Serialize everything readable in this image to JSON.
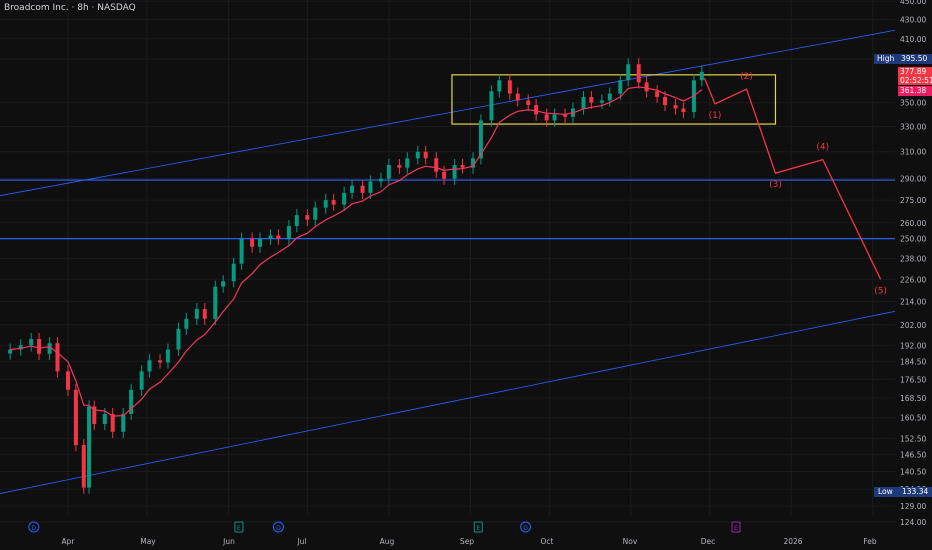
{
  "header": {
    "title": "Broadcom Inc. · 8h · NASDAQ"
  },
  "chart_data": {
    "type": "candlestick",
    "y_scale": "log",
    "ylim": [
      122,
      455
    ],
    "grid": true,
    "colors": {
      "up": "#089981",
      "down": "#f23645",
      "ema": "#f23660",
      "channel": "#2962ff",
      "box": "#e8d44d",
      "wave": "#f23645",
      "background": "#0f0f0f"
    },
    "y_ticks": [
      "450.00",
      "430.00",
      "410.00",
      "390.00",
      "350.00",
      "330.00",
      "310.00",
      "290.00",
      "275.00",
      "260.00",
      "250.00",
      "238.00",
      "226.00",
      "214.00",
      "202.00",
      "192.00",
      "184.50",
      "176.50",
      "168.50",
      "160.50",
      "152.50",
      "146.50",
      "140.50",
      "134.50",
      "129.00",
      "124.00"
    ],
    "x_ticks": [
      {
        "label": "Apr",
        "date": "2025-04-01"
      },
      {
        "label": "May",
        "date": "2025-05-01"
      },
      {
        "label": "Jun",
        "date": "2025-06-01"
      },
      {
        "label": "Jul",
        "date": "2025-07-01"
      },
      {
        "label": "Aug",
        "date": "2025-08-01"
      },
      {
        "label": "Sep",
        "date": "2025-09-01"
      },
      {
        "label": "Oct",
        "date": "2025-10-01"
      },
      {
        "label": "Nov",
        "date": "2025-11-01"
      },
      {
        "label": "Dec",
        "date": "2025-12-01"
      },
      {
        "label": "2026",
        "date": "2026-01-01"
      },
      {
        "label": "Feb",
        "date": "2026-02-01"
      }
    ],
    "closes": [
      [
        "2025-03-10",
        190
      ],
      [
        "2025-03-14",
        192
      ],
      [
        "2025-03-18",
        195
      ],
      [
        "2025-03-21",
        188
      ],
      [
        "2025-03-25",
        193
      ],
      [
        "2025-03-28",
        180
      ],
      [
        "2025-04-01",
        172
      ],
      [
        "2025-04-04",
        150
      ],
      [
        "2025-04-07",
        135
      ],
      [
        "2025-04-09",
        165
      ],
      [
        "2025-04-11",
        158
      ],
      [
        "2025-04-15",
        162
      ],
      [
        "2025-04-18",
        155
      ],
      [
        "2025-04-22",
        162
      ],
      [
        "2025-04-25",
        172
      ],
      [
        "2025-04-29",
        180
      ],
      [
        "2025-05-02",
        185
      ],
      [
        "2025-05-06",
        184
      ],
      [
        "2025-05-09",
        190
      ],
      [
        "2025-05-13",
        200
      ],
      [
        "2025-05-16",
        205
      ],
      [
        "2025-05-20",
        210
      ],
      [
        "2025-05-23",
        205
      ],
      [
        "2025-05-27",
        222
      ],
      [
        "2025-05-30",
        225
      ],
      [
        "2025-06-03",
        235
      ],
      [
        "2025-06-06",
        250
      ],
      [
        "2025-06-10",
        245
      ],
      [
        "2025-06-13",
        250
      ],
      [
        "2025-06-17",
        252
      ],
      [
        "2025-06-20",
        250
      ],
      [
        "2025-06-24",
        258
      ],
      [
        "2025-06-27",
        265
      ],
      [
        "2025-07-01",
        262
      ],
      [
        "2025-07-04",
        270
      ],
      [
        "2025-07-08",
        275
      ],
      [
        "2025-07-11",
        272
      ],
      [
        "2025-07-15",
        280
      ],
      [
        "2025-07-18",
        285
      ],
      [
        "2025-07-22",
        280
      ],
      [
        "2025-07-25",
        288
      ],
      [
        "2025-07-29",
        290
      ],
      [
        "2025-08-01",
        300
      ],
      [
        "2025-08-05",
        298
      ],
      [
        "2025-08-08",
        305
      ],
      [
        "2025-08-12",
        310
      ],
      [
        "2025-08-15",
        305
      ],
      [
        "2025-08-19",
        295
      ],
      [
        "2025-08-22",
        290
      ],
      [
        "2025-08-26",
        300
      ],
      [
        "2025-08-29",
        298
      ],
      [
        "2025-09-02",
        305
      ],
      [
        "2025-09-05",
        335
      ],
      [
        "2025-09-09",
        360
      ],
      [
        "2025-09-12",
        370
      ],
      [
        "2025-09-16",
        358
      ],
      [
        "2025-09-19",
        352
      ],
      [
        "2025-09-23",
        348
      ],
      [
        "2025-09-26",
        340
      ],
      [
        "2025-09-30",
        335
      ],
      [
        "2025-10-03",
        340
      ],
      [
        "2025-10-07",
        338
      ],
      [
        "2025-10-10",
        345
      ],
      [
        "2025-10-14",
        355
      ],
      [
        "2025-10-17",
        350
      ],
      [
        "2025-10-21",
        352
      ],
      [
        "2025-10-24",
        358
      ],
      [
        "2025-10-28",
        370
      ],
      [
        "2025-10-31",
        385
      ],
      [
        "2025-11-04",
        368
      ],
      [
        "2025-11-07",
        360
      ],
      [
        "2025-11-11",
        355
      ],
      [
        "2025-11-14",
        348
      ],
      [
        "2025-11-18",
        345
      ],
      [
        "2025-11-21",
        342
      ],
      [
        "2025-11-25",
        370
      ],
      [
        "2025-11-28",
        377.89
      ]
    ],
    "horizontal_levels": [
      289,
      250
    ],
    "channel": {
      "upper": [
        [
          "2025-03-06",
          278
        ],
        [
          "2026-02-10",
          419
        ]
      ],
      "lower": [
        [
          "2025-03-06",
          133
        ],
        [
          "2026-02-10",
          209
        ]
      ]
    },
    "range_box": {
      "from": "2025-08-25",
      "to": "2025-12-26",
      "high": 375,
      "low": 332
    },
    "wave_projection": [
      {
        "date": "2025-11-29",
        "price": 372,
        "label": ""
      },
      {
        "date": "2025-12-03",
        "price": 349,
        "label": "(1)"
      },
      {
        "date": "2025-12-15",
        "price": 362,
        "label": "(2)"
      },
      {
        "date": "2025-12-26",
        "price": 294,
        "label": "(3)"
      },
      {
        "date": "2026-01-13",
        "price": 304,
        "label": "(4)"
      },
      {
        "date": "2026-02-04",
        "price": 226,
        "label": "(5)"
      }
    ],
    "price_labels": {
      "high": {
        "label": "High",
        "value": "395.50"
      },
      "last": {
        "value": "377.89",
        "countdown": "02:52:51"
      },
      "ema": {
        "value": "361.38"
      },
      "low": {
        "label": "Low",
        "value": "133.34"
      }
    },
    "events": [
      {
        "type": "D",
        "date": "2025-03-19",
        "color": "#2962ff"
      },
      {
        "type": "E",
        "date": "2025-06-05",
        "color": "#089981"
      },
      {
        "type": "D",
        "date": "2025-06-20",
        "color": "#2962ff"
      },
      {
        "type": "E",
        "date": "2025-09-04",
        "color": "#089981"
      },
      {
        "type": "D",
        "date": "2025-09-22",
        "color": "#2962ff"
      },
      {
        "type": "E",
        "date": "2025-12-11",
        "color": "#9c27b0"
      }
    ]
  }
}
